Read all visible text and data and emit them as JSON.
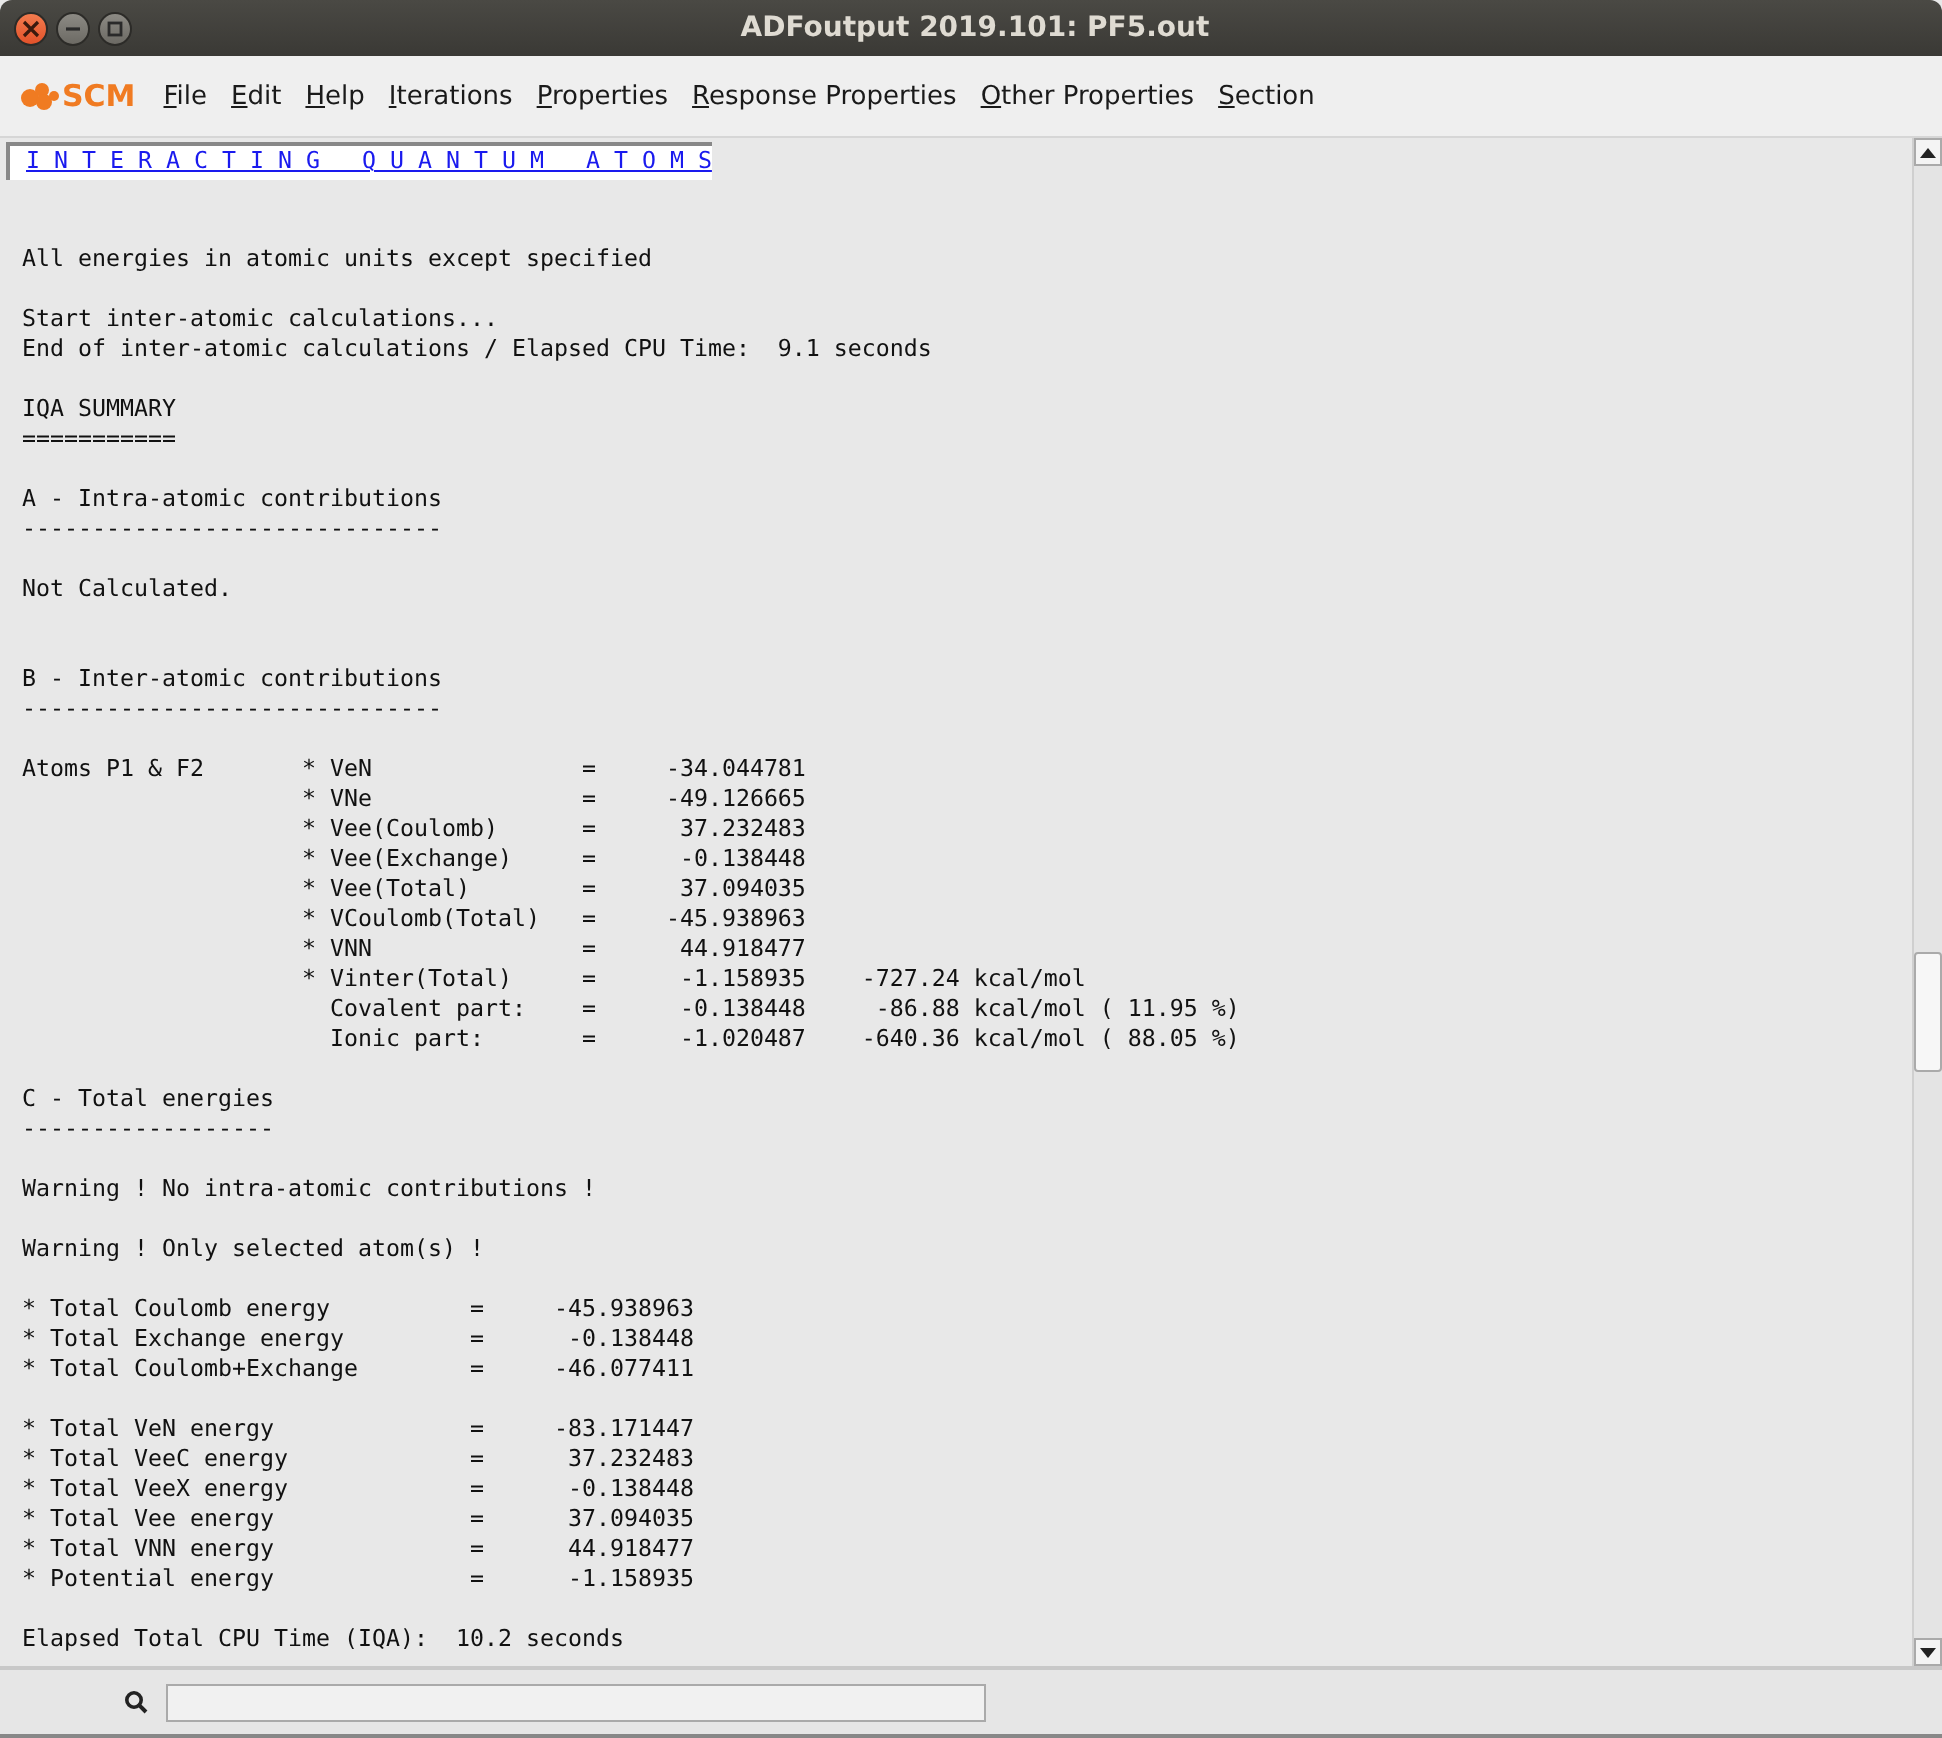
{
  "window": {
    "title": "ADFoutput 2019.101: PF5.out"
  },
  "logo": {
    "text": "SCM"
  },
  "menu": [
    "File",
    "Edit",
    "Help",
    "Iterations",
    "Properties",
    "Response Properties",
    "Other Properties",
    "Section"
  ],
  "header_link": "I N T E R A C T I N G   Q U A N T U M   A T O M S",
  "sections": [
    {
      "blocks": [
        [
          "All energies in atomic units except specified"
        ],
        [
          "Start inter-atomic calculations...",
          "End of inter-atomic calculations / Elapsed CPU Time:  9.1 seconds"
        ],
        [
          "IQA SUMMARY",
          "==========="
        ],
        [
          "A - Intra-atomic contributions",
          "------------------------------"
        ],
        [
          "Not Calculated."
        ]
      ]
    },
    {
      "blocks": [
        [
          "B - Inter-atomic contributions",
          "------------------------------"
        ],
        [
          "Atoms P1 & F2       * VeN               =     -34.044781",
          "                    * VNe               =     -49.126665",
          "                    * Vee(Coulomb)      =      37.232483",
          "                    * Vee(Exchange)     =      -0.138448",
          "                    * Vee(Total)        =      37.094035",
          "                    * VCoulomb(Total)   =     -45.938963",
          "                    * VNN               =      44.918477",
          "                    * Vinter(Total)     =      -1.158935    -727.24 kcal/mol",
          "                      Covalent part:    =      -0.138448     -86.88 kcal/mol ( 11.95 %)",
          "                      Ionic part:       =      -1.020487    -640.36 kcal/mol ( 88.05 %)"
        ],
        [
          "C - Total energies",
          "------------------"
        ],
        [
          "Warning ! No intra-atomic contributions !"
        ],
        [
          "Warning ! Only selected atom(s) !"
        ],
        [
          "* Total Coulomb energy          =     -45.938963",
          "* Total Exchange energy         =      -0.138448",
          "* Total Coulomb+Exchange        =     -46.077411"
        ],
        [
          "* Total VeN energy              =     -83.171447",
          "* Total VeeC energy             =      37.232483",
          "* Total VeeX energy             =      -0.138448",
          "* Total Vee energy              =      37.094035",
          "* Total VNN energy              =      44.918477",
          "* Potential energy              =      -1.158935"
        ],
        [
          "Elapsed Total CPU Time (IQA):  10.2 seconds"
        ]
      ]
    }
  ]
}
